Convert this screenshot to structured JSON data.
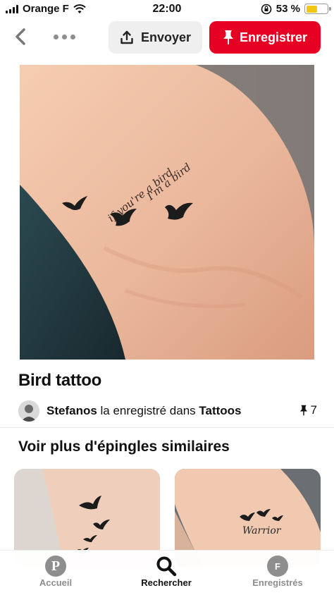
{
  "status_bar": {
    "carrier": "Orange F",
    "time": "22:00",
    "battery_percent": "53 %",
    "battery_level": 0.53,
    "battery_color": "#f2c617"
  },
  "toolbar": {
    "send_label": "Envoyer",
    "save_label": "Enregistrer",
    "save_color": "#e60023"
  },
  "pin": {
    "tattoo_text_line1": "if you're a bird,",
    "tattoo_text_line2": "I'm a bird",
    "title": "Bird tattoo",
    "saved_by": "Stefanos",
    "saved_middle": " la enregistré dans ",
    "board": "Tattoos",
    "save_count": "7"
  },
  "similar": {
    "title": "Voir plus d'épingles similaires",
    "thumb2_text": "Warrior"
  },
  "bottom_nav": {
    "items": [
      {
        "label": "Accueil",
        "icon": "pinterest-logo-icon"
      },
      {
        "label": "Rechercher",
        "icon": "search-icon"
      },
      {
        "label": "Enregistrés",
        "icon": "profile-avatar-icon",
        "initial": "F"
      }
    ]
  }
}
